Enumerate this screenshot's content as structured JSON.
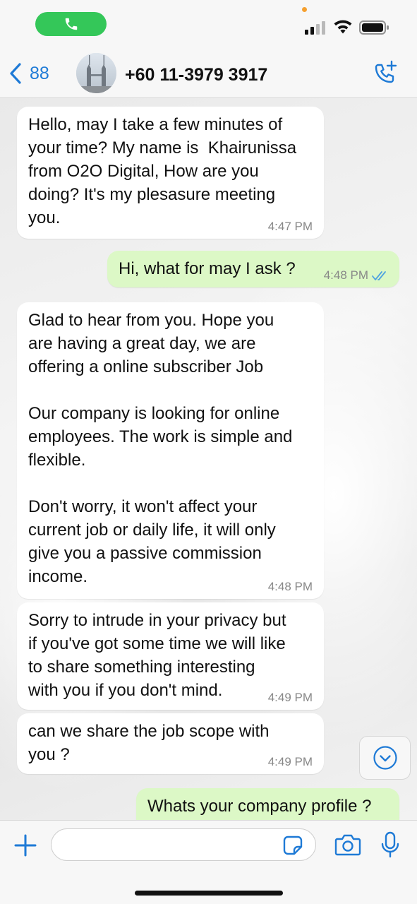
{
  "header": {
    "back_count": "88",
    "contact_name": "+60 11-3979 3917"
  },
  "messages": [
    {
      "direction": "incoming",
      "text": "Hello, may I take a few minutes of\nyour time? My name is  Khairunissa\nfrom O2O Digital, How are you\ndoing? It's my plesasure meeting\nyou.",
      "time": "4:47 PM"
    },
    {
      "direction": "outgoing",
      "text": "Hi, what for may I ask ?",
      "time": "4:48 PM",
      "status": "read"
    },
    {
      "direction": "incoming",
      "text": "Glad to hear from you. Hope you\nare having a great day, we are\noffering a online subscriber Job\n\nOur company is looking for online\nemployees. The work is simple and\nflexible.\n\nDon't worry, it won't affect your\ncurrent job or daily life, it will only\ngive you a passive commission\nincome.",
      "time": "4:48 PM"
    },
    {
      "direction": "incoming",
      "text": "Sorry to intrude in your privacy but\nif you've got some time we will like\nto share something interesting\nwith you if you don't mind.",
      "time": "4:49 PM"
    },
    {
      "direction": "incoming",
      "text": "can we share the job scope with\nyou ?",
      "time": "4:49 PM"
    },
    {
      "direction": "outgoing",
      "text": "Whats your company profile ?",
      "time": ""
    }
  ],
  "input": {
    "value": "",
    "placeholder": ""
  },
  "icons": {
    "call": "phone-icon",
    "back": "chevron-left-icon",
    "add_call": "phone-plus-icon",
    "scroll_down": "chevron-down-circle-icon",
    "plus": "plus-icon",
    "sticker": "sticker-icon",
    "camera": "camera-icon",
    "mic": "microphone-icon"
  },
  "colors": {
    "accent": "#1e7ad6",
    "call_pill": "#34c759",
    "outgoing_bubble": "#dcf8c6",
    "incoming_bubble": "#ffffff",
    "read_ticks": "#4fa3e0"
  }
}
